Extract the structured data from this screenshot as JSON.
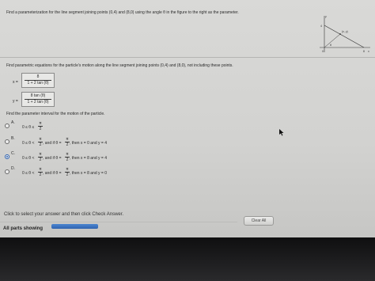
{
  "question": {
    "prompt": "Find a parameterization for the line segment joining points (0,4) and (8,0) using the angle θ in the figure to the right as the parameter."
  },
  "figure": {
    "x_axis_label": "x",
    "y_axis_label": "y",
    "y_intercept_label": "4",
    "x_intercept_label": "8",
    "origin_label": "0",
    "point_label": "(x, y)",
    "angle_label": "θ"
  },
  "part1": {
    "prompt": "Find parametric equations for the particle's motion along the line segment joining points (0,4) and (8,0), not including these points.",
    "x_eq_label": "x =",
    "x_numerator": "8",
    "x_denominator": "1 + 2 tan (θ)",
    "y_eq_label": "y =",
    "y_numerator": "8 tan (θ)",
    "y_denominator": "1 + 2 tan (θ)"
  },
  "part2": {
    "prompt": "Find the parameter interval for the motion of the particle.",
    "options": [
      {
        "letter": "A.",
        "prefix": "0 ≤ θ ≤",
        "num": "π",
        "den": "2",
        "suffix": ""
      },
      {
        "letter": "B.",
        "prefix": "0 ≤ θ <",
        "num": "π",
        "den": "2",
        "mid": ", and if θ =",
        "num2": "π",
        "den2": "2",
        "suffix": ", then x = 0 and y = 4"
      },
      {
        "letter": "C.",
        "prefix": "0 ≤ θ <",
        "num": "π",
        "den": "2",
        "mid": ", and if θ =",
        "num2": "π",
        "den2": "2",
        "suffix": ", then x = 8 and y = 4"
      },
      {
        "letter": "D.",
        "prefix": "0 ≤ θ <",
        "num": "π",
        "den": "2",
        "mid": ", and if θ =",
        "num2": "π",
        "den2": "2",
        "suffix": ", then x = 8 and y = 0"
      }
    ],
    "selected_option": "C."
  },
  "footer": {
    "instruction": "Click to select your answer and then click Check Answer.",
    "clear_all": "Clear All",
    "parts_status": "All parts showing"
  }
}
